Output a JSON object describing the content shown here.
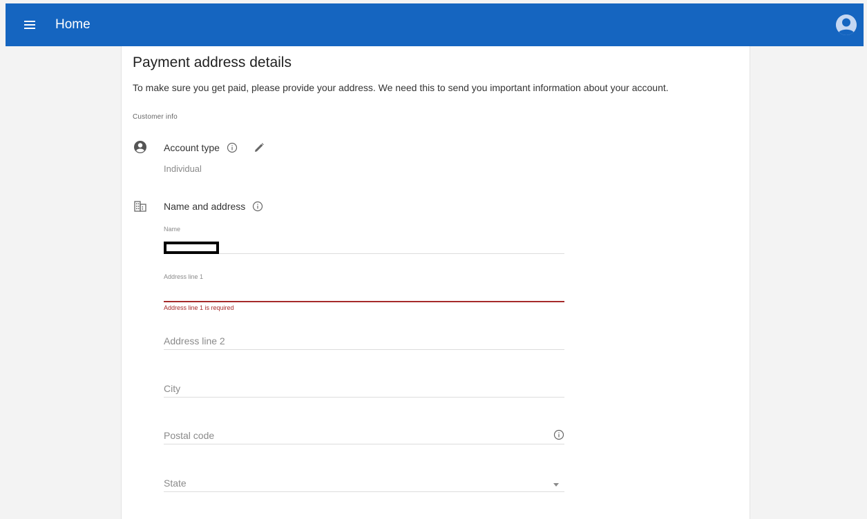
{
  "header": {
    "title": "Home",
    "menu_icon": "menu-icon",
    "avatar_icon": "account-avatar-icon",
    "bar_color": "#1565c0"
  },
  "page": {
    "title": "Payment address details",
    "description": "To make sure you get paid, please provide your address. We need this to send you important information about your account.",
    "section_label": "Customer info"
  },
  "account_type": {
    "icon": "account-circle-icon",
    "label": "Account type",
    "value": "Individual"
  },
  "name_address": {
    "icon": "building-icon",
    "label": "Name and address",
    "name_field": {
      "label": "Name",
      "value": ""
    },
    "address_line1": {
      "label": "Address line 1",
      "value": "",
      "error": "Address line 1 is required",
      "error_color": "#a52a2a"
    },
    "address_line2": {
      "placeholder": "Address line 2",
      "value": ""
    },
    "city": {
      "placeholder": "City",
      "value": ""
    },
    "postal_code": {
      "placeholder": "Postal code",
      "value": ""
    },
    "state": {
      "placeholder": "State",
      "value": ""
    }
  }
}
